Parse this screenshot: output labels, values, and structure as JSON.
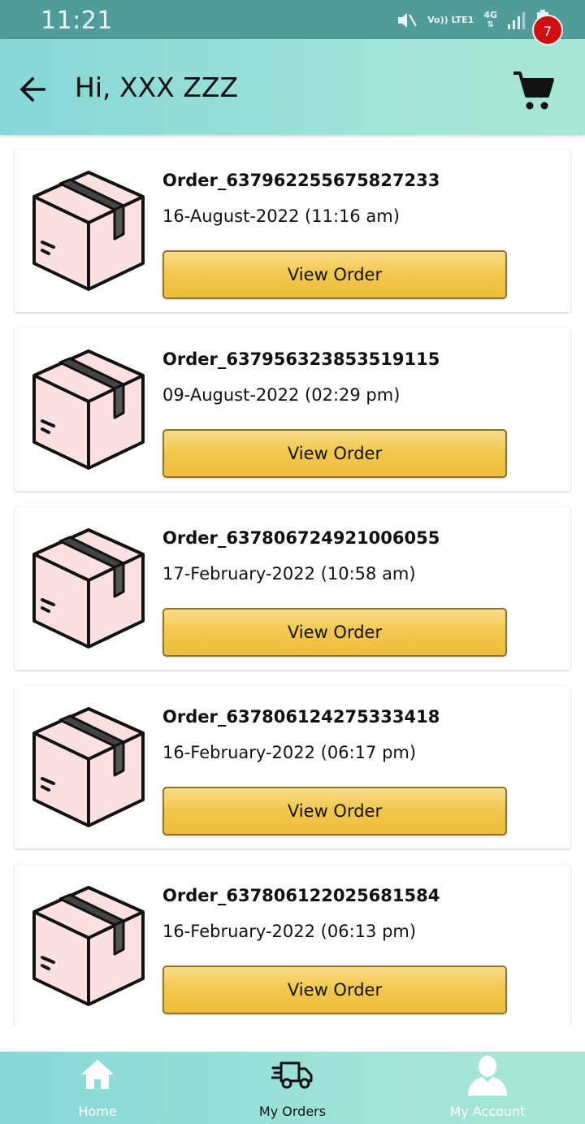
{
  "status_bar": {
    "time": "11:21",
    "network_top": "Vo)) LTE1",
    "network_type": "4G",
    "icons": [
      "mute-icon",
      "signal-icon",
      "battery-charging-icon"
    ]
  },
  "header": {
    "greeting": "Hi, XXX ZZZ",
    "back_icon": "arrow-left-icon",
    "cart_icon": "shopping-cart-icon",
    "cart_count": "7"
  },
  "orders": [
    {
      "id": "Order_637962255675827233",
      "date": "16-August-2022 (11:16 am)",
      "button": "View Order"
    },
    {
      "id": "Order_637956323853519115",
      "date": "09-August-2022 (02:29 pm)",
      "button": "View Order"
    },
    {
      "id": "Order_637806724921006055",
      "date": "17-February-2022 (10:58 am)",
      "button": "View Order"
    },
    {
      "id": "Order_637806124275333418",
      "date": "16-February-2022 (06:17 pm)",
      "button": "View Order"
    },
    {
      "id": "Order_637806122025681584",
      "date": "16-February-2022 (06:13 pm)",
      "button": "View Order"
    }
  ],
  "bottom_nav": {
    "items": [
      {
        "label": "Home",
        "icon": "home-icon"
      },
      {
        "label": "My Orders",
        "icon": "delivery-truck-icon",
        "active": true
      },
      {
        "label": "My Account",
        "icon": "user-icon"
      }
    ]
  },
  "colors": {
    "status_bar": "#4f9c9b",
    "header_start": "#86d7d9",
    "header_end": "#a7e6d4",
    "button_fill": "#f2c84f",
    "badge": "#d01010",
    "box_fill": "#fde0e0"
  }
}
